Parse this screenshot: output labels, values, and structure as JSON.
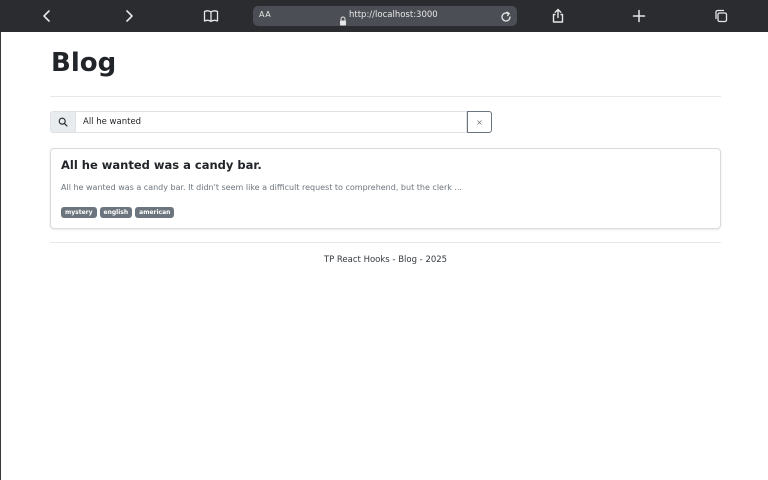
{
  "browser": {
    "text_size_label": "AA",
    "url": "http://localhost:3000",
    "icons": {
      "back": "chevron-left-icon",
      "forward": "chevron-right-icon",
      "reader": "book-icon",
      "lock": "lock-icon",
      "reload": "reload-icon",
      "share": "share-icon",
      "new_tab": "plus-icon",
      "tabs": "tabs-icon"
    },
    "colors": {
      "toolbar_bg": "#2a2c30",
      "address_bg": "#4b4e54",
      "icon": "#e6e6e6"
    }
  },
  "page": {
    "title": "Blog",
    "search": {
      "icon": "search-icon",
      "value": "All he wanted",
      "clear_label": "×"
    },
    "posts": [
      {
        "title": "All he wanted was a candy bar.",
        "excerpt": "All he wanted was a candy bar. It didn't seem like a difficult request to comprehend, but the clerk ...",
        "tags": [
          "mystery",
          "english",
          "american"
        ]
      }
    ],
    "footer": "TP React Hooks - Blog - 2025",
    "colors": {
      "badge_bg": "#6c757d",
      "text": "#212529",
      "muted": "#6c757d"
    }
  }
}
